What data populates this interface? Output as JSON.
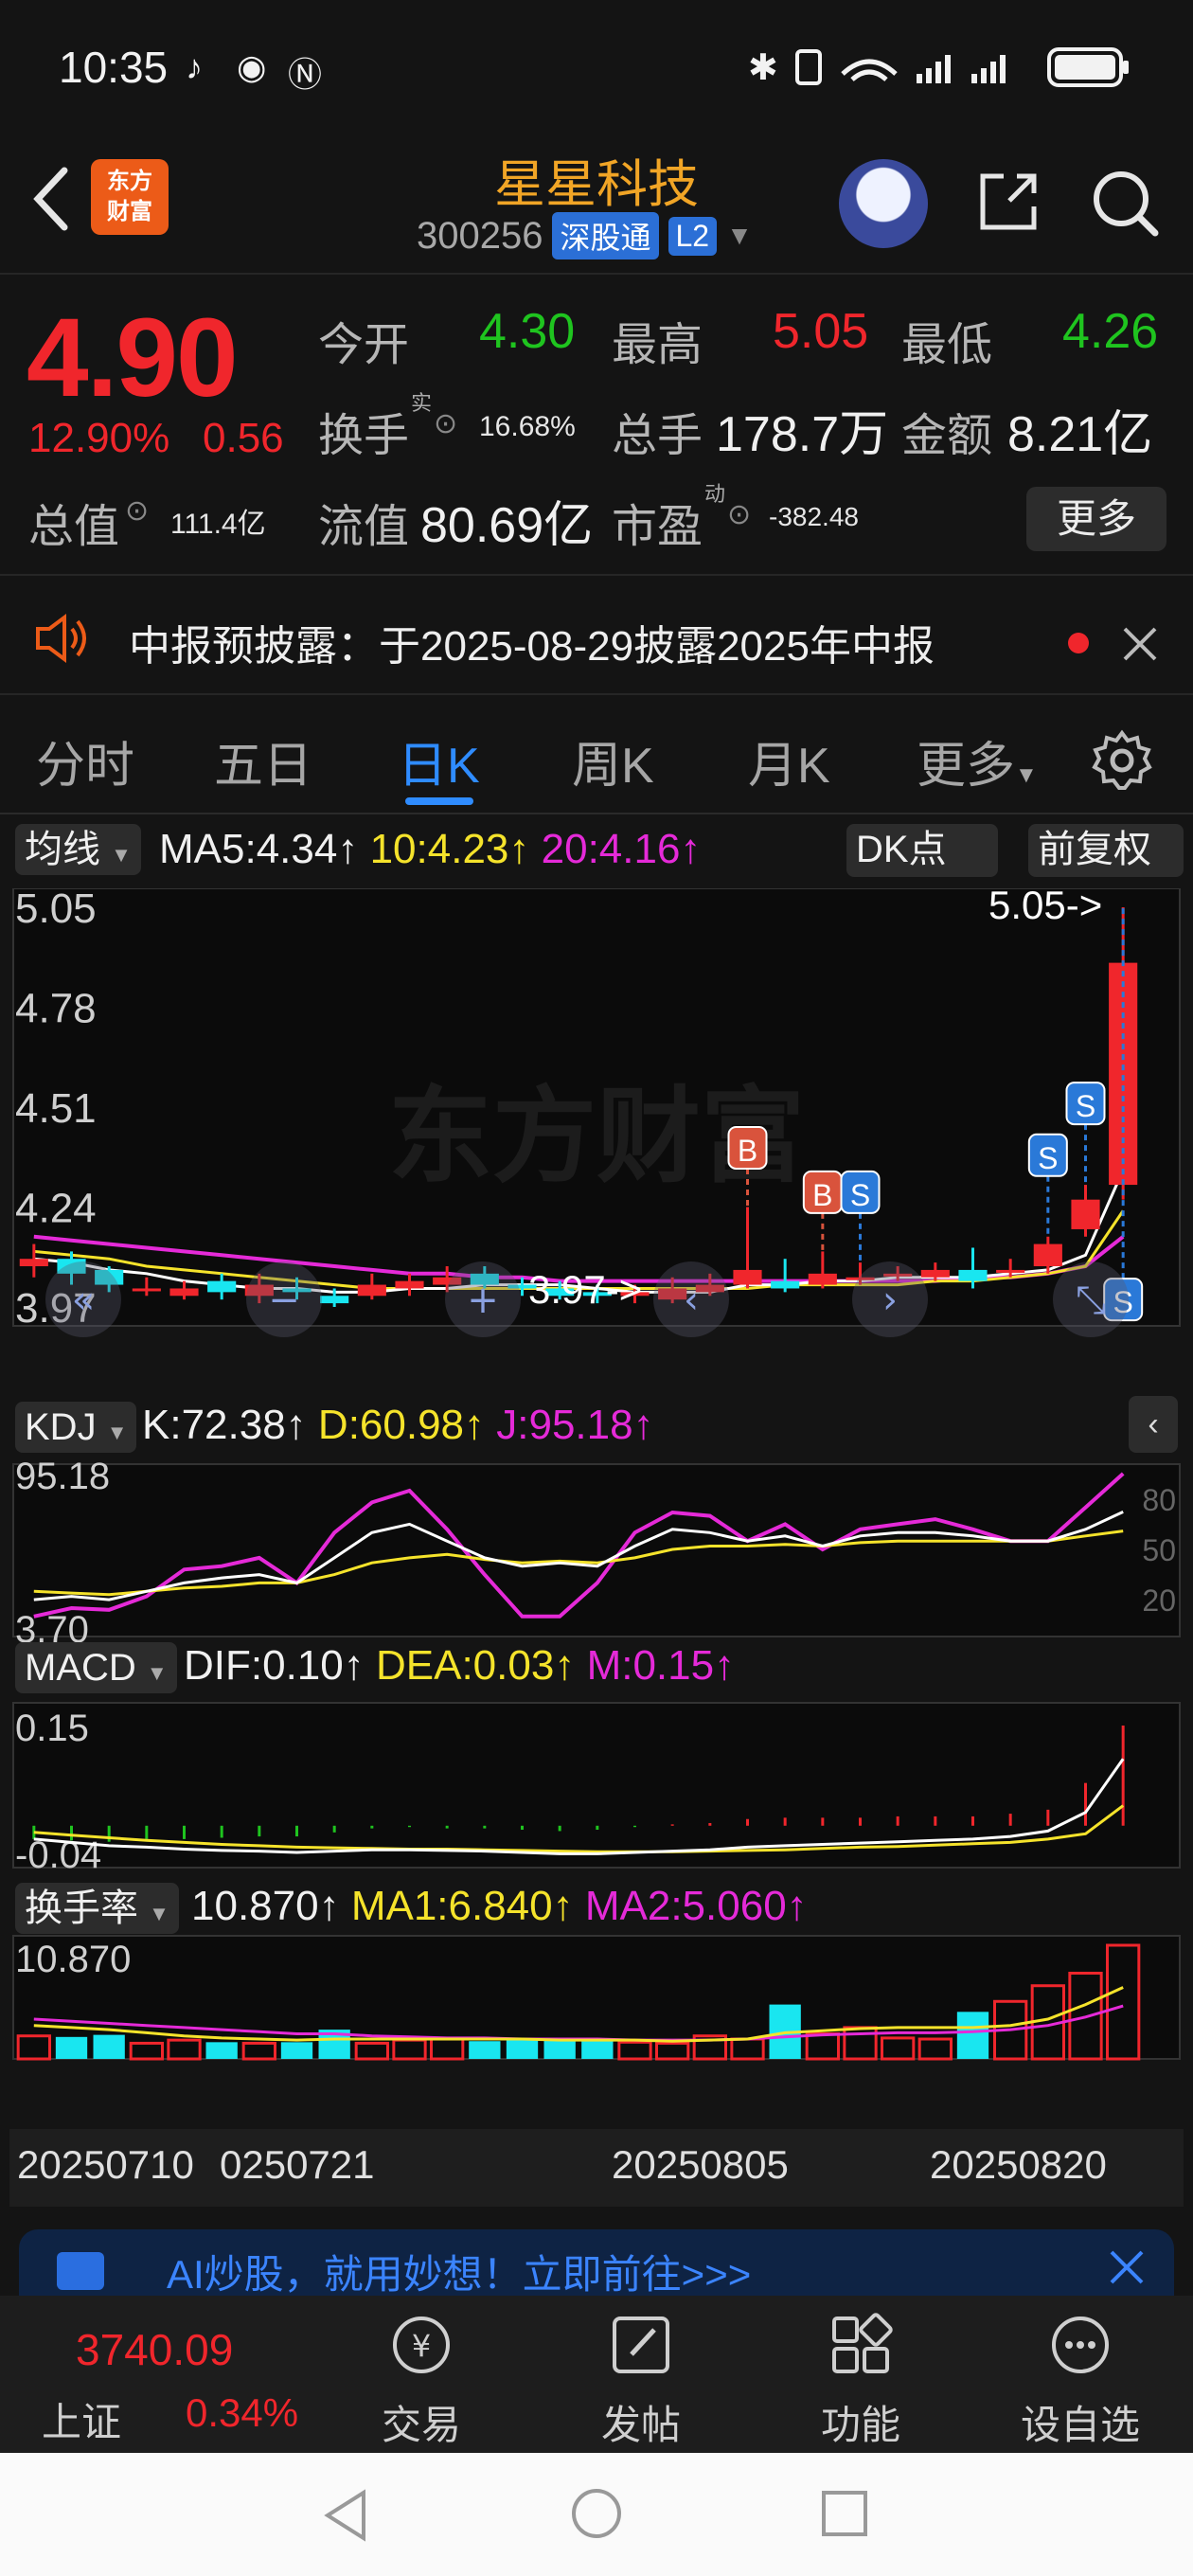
{
  "status_bar": {
    "time": "10:35",
    "icons": [
      "tiktok-icon",
      "app-icon",
      "nfc-icon",
      "bluetooth-icon",
      "vibrate-icon",
      "wifi-icon",
      "signal-icon",
      "signal-icon",
      "battery-icon"
    ]
  },
  "header": {
    "stock_name": "星星科技",
    "code": "300256",
    "tag_connect": "深股通",
    "tag_level": "L2",
    "logo_line1": "东方",
    "logo_line2": "财富"
  },
  "quote": {
    "price": "4.90",
    "change_pct": "12.90%",
    "change_abs": "0.56",
    "open_label": "今开",
    "open": "4.30",
    "high_label": "最高",
    "high": "5.05",
    "low_label": "最低",
    "low": "4.26",
    "turnover_label": "换手",
    "turnover_sup": "实",
    "turnover": "16.68%",
    "volume_label": "总手",
    "volume": "178.7万",
    "amount_label": "金额",
    "amount": "8.21亿",
    "mcap_label": "总值",
    "mcap": "111.4亿",
    "float_label": "流值",
    "float_cap": "80.69亿",
    "pe_label": "市盈",
    "pe_sup": "动",
    "pe": "-382.48",
    "more_label": "更多"
  },
  "notice": {
    "text": "中报预披露：于2025-08-29披露2025年中报"
  },
  "tabs": [
    "分时",
    "五日",
    "日K",
    "周K",
    "月K",
    "更多"
  ],
  "active_tab": "日K",
  "colors": {
    "up": "#f0262c",
    "down": "#19e6f0",
    "ma5": "#ffffff",
    "ma10": "#f5e32b",
    "ma20": "#e52ad8",
    "accent": "#2f8cff"
  },
  "chart": {
    "ma_chip": "均线",
    "ma5_label": "MA5:4.34↑",
    "ma10_label": "10:4.23↑",
    "ma20_label": "20:4.16↑",
    "dk_label": "DK点",
    "fq_label": "前复权",
    "price_ticks": [
      "5.05",
      "4.78",
      "4.51",
      "4.24",
      "3.97"
    ],
    "high_mark": "5.05->",
    "low_mark": "3.97->",
    "watermark": "东方财富",
    "kdj_chip": "KDJ",
    "k_label": "K:72.38↑",
    "d_label": "D:60.98↑",
    "j_label": "J:95.18↑",
    "kdj_ticks": [
      "95.18",
      "3.70"
    ],
    "kdj_levels": [
      "80",
      "50",
      "20"
    ],
    "macd_chip": "MACD",
    "dif_label": "DIF:0.10↑",
    "dea_label": "DEA:0.03↑",
    "m_label": "M:0.15↑",
    "macd_ticks": [
      "0.15",
      "-0.04"
    ],
    "turn_chip": "换手率",
    "turn_label": "10.870↑",
    "turn_ma1": "MA1:6.840↑",
    "turn_ma2": "MA2:5.060↑",
    "turn_tick": "10.870",
    "dates": [
      "20250710",
      "0250721",
      "20250805",
      "20250820"
    ]
  },
  "chart_data": {
    "type": "candlestick",
    "candles": [
      {
        "o": 4.08,
        "c": 4.1,
        "h": 4.14,
        "l": 4.05
      },
      {
        "o": 4.1,
        "c": 4.06,
        "h": 4.12,
        "l": 4.03
      },
      {
        "o": 4.07,
        "c": 4.03,
        "h": 4.08,
        "l": 4.01
      },
      {
        "o": 4.02,
        "c": 4.02,
        "h": 4.05,
        "l": 4.0
      },
      {
        "o": 4.0,
        "c": 4.02,
        "h": 4.04,
        "l": 3.99
      },
      {
        "o": 4.04,
        "c": 4.01,
        "h": 4.06,
        "l": 3.99
      },
      {
        "o": 4.0,
        "c": 4.03,
        "h": 4.06,
        "l": 3.98
      },
      {
        "o": 4.02,
        "c": 4.01,
        "h": 4.05,
        "l": 3.99
      },
      {
        "o": 4.0,
        "c": 3.98,
        "h": 4.02,
        "l": 3.97
      },
      {
        "o": 4.0,
        "c": 4.03,
        "h": 4.06,
        "l": 3.99
      },
      {
        "o": 4.02,
        "c": 4.04,
        "h": 4.06,
        "l": 4.0
      },
      {
        "o": 4.03,
        "c": 4.05,
        "h": 4.08,
        "l": 4.01
      },
      {
        "o": 4.06,
        "c": 4.03,
        "h": 4.08,
        "l": 4.02
      },
      {
        "o": 4.03,
        "c": 4.02,
        "h": 4.05,
        "l": 4.0
      },
      {
        "o": 4.02,
        "c": 4.0,
        "h": 4.04,
        "l": 3.99
      },
      {
        "o": 4.01,
        "c": 4.0,
        "h": 4.03,
        "l": 3.98
      },
      {
        "o": 4.0,
        "c": 4.01,
        "h": 4.03,
        "l": 3.98
      },
      {
        "o": 3.99,
        "c": 4.02,
        "h": 4.05,
        "l": 3.98
      },
      {
        "o": 4.01,
        "c": 4.03,
        "h": 4.06,
        "l": 4.0
      },
      {
        "o": 4.03,
        "c": 4.07,
        "h": 4.24,
        "l": 4.02
      },
      {
        "o": 4.04,
        "c": 4.02,
        "h": 4.1,
        "l": 4.01
      },
      {
        "o": 4.03,
        "c": 4.06,
        "h": 4.12,
        "l": 4.02
      },
      {
        "o": 4.05,
        "c": 4.05,
        "h": 4.09,
        "l": 4.03
      },
      {
        "o": 4.06,
        "c": 4.06,
        "h": 4.08,
        "l": 4.04
      },
      {
        "o": 4.05,
        "c": 4.07,
        "h": 4.09,
        "l": 4.04
      },
      {
        "o": 4.07,
        "c": 4.04,
        "h": 4.13,
        "l": 4.02
      },
      {
        "o": 4.07,
        "c": 4.07,
        "h": 4.1,
        "l": 4.05
      },
      {
        "o": 4.08,
        "c": 4.14,
        "h": 4.16,
        "l": 4.06
      },
      {
        "o": 4.18,
        "c": 4.26,
        "h": 4.3,
        "l": 4.16
      },
      {
        "o": 4.3,
        "c": 4.9,
        "h": 5.05,
        "l": 4.26
      }
    ],
    "ma5": [
      4.1,
      4.09,
      4.07,
      4.06,
      4.04,
      4.03,
      4.02,
      4.02,
      4.01,
      4.01,
      4.02,
      4.02,
      4.03,
      4.03,
      4.03,
      4.02,
      4.01,
      4.01,
      4.01,
      4.03,
      4.03,
      4.04,
      4.04,
      4.05,
      4.05,
      4.05,
      4.06,
      4.07,
      4.11,
      4.34
    ],
    "ma10": [
      4.12,
      4.11,
      4.1,
      4.08,
      4.07,
      4.06,
      4.05,
      4.04,
      4.03,
      4.02,
      4.02,
      4.02,
      4.02,
      4.02,
      4.02,
      4.02,
      4.02,
      4.02,
      4.02,
      4.02,
      4.03,
      4.03,
      4.03,
      4.03,
      4.04,
      4.04,
      4.05,
      4.06,
      4.08,
      4.23
    ],
    "ma20": [
      4.16,
      4.15,
      4.14,
      4.13,
      4.12,
      4.11,
      4.1,
      4.09,
      4.08,
      4.07,
      4.06,
      4.06,
      4.05,
      4.05,
      4.04,
      4.04,
      4.04,
      4.04,
      4.04,
      4.04,
      4.04,
      4.04,
      4.04,
      4.04,
      4.04,
      4.05,
      4.05,
      4.06,
      4.08,
      4.16
    ],
    "signals": [
      {
        "i": 19,
        "t": "B",
        "p": 4.4
      },
      {
        "i": 21,
        "t": "B",
        "p": 4.28
      },
      {
        "i": 22,
        "t": "S",
        "p": 4.28
      },
      {
        "i": 27,
        "t": "S",
        "p": 4.38
      },
      {
        "i": 28,
        "t": "S",
        "p": 4.52
      },
      {
        "i": 29,
        "t": "S",
        "p": 3.99
      }
    ],
    "price_range": [
      3.97,
      5.05
    ],
    "kdj": {
      "k": [
        20,
        22,
        20,
        25,
        30,
        33,
        35,
        30,
        45,
        60,
        65,
        55,
        45,
        40,
        42,
        40,
        52,
        62,
        60,
        55,
        58,
        52,
        58,
        60,
        60,
        58,
        55,
        55,
        62,
        72.38
      ],
      "d": [
        25,
        24,
        23,
        25,
        27,
        28,
        30,
        30,
        35,
        42,
        45,
        47,
        44,
        42,
        43,
        42,
        45,
        50,
        52,
        52,
        53,
        52,
        54,
        55,
        55,
        55,
        55,
        55,
        58,
        60.98
      ],
      "j": [
        10,
        15,
        14,
        22,
        38,
        40,
        45,
        30,
        60,
        78,
        85,
        62,
        35,
        10,
        10,
        30,
        60,
        72,
        70,
        55,
        65,
        50,
        62,
        65,
        68,
        62,
        55,
        55,
        75,
        95.18
      ],
      "range": [
        3.7,
        95.18
      ]
    },
    "macd": {
      "dif": [
        -0.02,
        -0.025,
        -0.03,
        -0.032,
        -0.035,
        -0.037,
        -0.038,
        -0.04,
        -0.038,
        -0.036,
        -0.036,
        -0.037,
        -0.038,
        -0.04,
        -0.042,
        -0.042,
        -0.04,
        -0.038,
        -0.036,
        -0.032,
        -0.03,
        -0.028,
        -0.026,
        -0.024,
        -0.022,
        -0.02,
        -0.016,
        -0.008,
        0.02,
        0.1
      ],
      "dea": [
        -0.01,
        -0.014,
        -0.018,
        -0.022,
        -0.025,
        -0.028,
        -0.03,
        -0.032,
        -0.033,
        -0.034,
        -0.035,
        -0.035,
        -0.036,
        -0.037,
        -0.038,
        -0.039,
        -0.039,
        -0.039,
        -0.038,
        -0.037,
        -0.036,
        -0.034,
        -0.032,
        -0.031,
        -0.029,
        -0.027,
        -0.025,
        -0.02,
        -0.012,
        0.03
      ],
      "m": [
        -0.02,
        -0.022,
        -0.024,
        -0.02,
        -0.02,
        -0.018,
        -0.016,
        -0.016,
        -0.01,
        -0.004,
        -0.002,
        -0.004,
        -0.004,
        -0.006,
        -0.008,
        -0.006,
        -0.002,
        0.002,
        0.004,
        0.01,
        0.012,
        0.012,
        0.012,
        0.014,
        0.014,
        0.014,
        0.018,
        0.024,
        0.064,
        0.15
      ],
      "range": [
        -0.04,
        0.15
      ]
    },
    "turnover": {
      "values": [
        2.2,
        2.1,
        2.3,
        1.5,
        1.8,
        1.6,
        1.5,
        1.6,
        2.8,
        1.5,
        1.8,
        1.9,
        1.7,
        1.9,
        1.8,
        1.7,
        1.6,
        1.5,
        2.2,
        1.9,
        5.2,
        2.4,
        3.0,
        2.0,
        1.9,
        4.5,
        5.5,
        7.0,
        8.2,
        10.87
      ],
      "ma1": [
        3.2,
        3.0,
        2.8,
        2.5,
        2.2,
        2.0,
        1.9,
        1.8,
        1.9,
        1.9,
        1.9,
        1.9,
        1.9,
        1.9,
        1.8,
        1.8,
        1.8,
        1.7,
        1.8,
        1.9,
        2.5,
        2.7,
        2.9,
        3.0,
        3.0,
        3.0,
        3.2,
        3.8,
        5.2,
        6.84
      ],
      "ma2": [
        3.8,
        3.6,
        3.4,
        3.2,
        3.0,
        2.8,
        2.6,
        2.4,
        2.4,
        2.2,
        2.1,
        2.0,
        2.0,
        1.9,
        1.9,
        1.9,
        1.8,
        1.8,
        1.8,
        1.9,
        2.1,
        2.3,
        2.4,
        2.5,
        2.5,
        2.6,
        2.8,
        3.2,
        4.0,
        5.06
      ],
      "range": [
        0,
        10.87
      ]
    },
    "xlabels": [
      "20250710",
      "0250721",
      "20250805",
      "20250820"
    ]
  },
  "ad": {
    "text": "AI炒股，就用妙想！立即前往>>>"
  },
  "bottom_nav": {
    "index_value": "3740.09",
    "index_name": "上证",
    "index_change": "0.34%",
    "items": [
      "交易",
      "发帖",
      "功能",
      "设自选"
    ]
  }
}
